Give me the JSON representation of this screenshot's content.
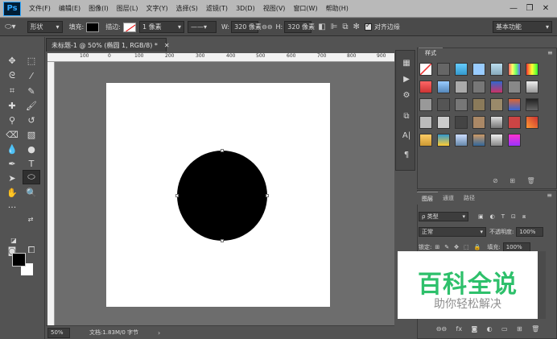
{
  "app": {
    "logo": "Ps"
  },
  "menu": [
    "文件(F)",
    "编辑(E)",
    "图像(I)",
    "图层(L)",
    "文字(Y)",
    "选择(S)",
    "滤镜(T)",
    "3D(D)",
    "视图(V)",
    "窗口(W)",
    "帮助(H)"
  ],
  "window_controls": {
    "minimize": "—",
    "restore": "❐",
    "close": "✕"
  },
  "options": {
    "mode": "形状",
    "fill_label": "填充:",
    "stroke_label": "描边:",
    "stroke_width": "1 像素",
    "w_label": "W:",
    "w_value": "320 像素",
    "link": "⊖⊖",
    "h_label": "H:",
    "h_value": "320 像素",
    "align_edges": "对齐边缘",
    "workspace": "基本功能"
  },
  "document": {
    "tab_title": "未标题-1 @ 50% (椭圆 1, RGB/8) *",
    "ruler_labels": [
      "100",
      "0",
      "100",
      "200",
      "300",
      "400",
      "500",
      "600",
      "700",
      "800",
      "900"
    ],
    "zoom": "50%",
    "doc_info": "文档:1.83M/0 字节"
  },
  "styles_panel": {
    "tab": "样式"
  },
  "layers_panel": {
    "tabs": [
      "图层",
      "通道",
      "路径"
    ],
    "filter_label": "ρ 类型",
    "blend_mode": "正常",
    "opacity_label": "不透明度:",
    "opacity_value": "100%",
    "lock_label": "锁定:",
    "fill_label": "填充:",
    "fill_value": "100%"
  },
  "watermark": {
    "title": "百科全说",
    "subtitle": "助你轻松解决"
  },
  "colors": {
    "foreground": "#000000",
    "background": "#ffffff",
    "accent": "#31a8ff",
    "watermark_green": "#2ec06b"
  }
}
